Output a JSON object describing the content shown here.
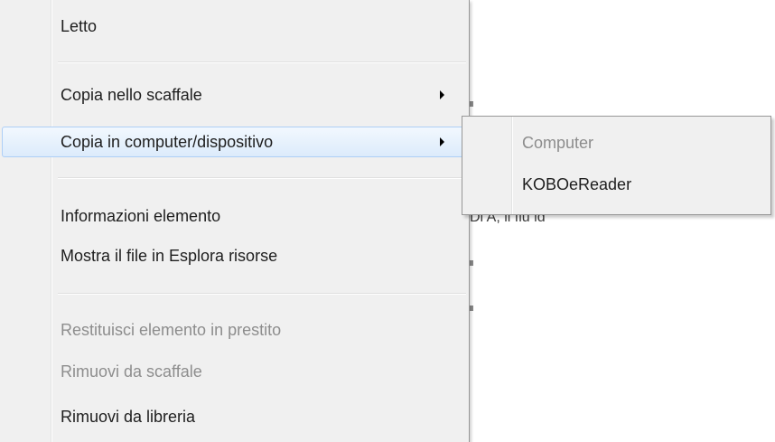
{
  "background": {
    "partial_text": "Di A, il fiu ld"
  },
  "context_menu": {
    "items": [
      {
        "label": "Letto",
        "disabled": false,
        "submenu": false
      },
      {
        "label": "Copia nello scaffale",
        "disabled": false,
        "submenu": true
      },
      {
        "label": "Copia in computer/dispositivo",
        "disabled": false,
        "submenu": true,
        "highlighted": true
      },
      {
        "label": "Informazioni elemento",
        "disabled": false,
        "submenu": false
      },
      {
        "label": "Mostra il file in Esplora risorse",
        "disabled": false,
        "submenu": false
      },
      {
        "label": "Restituisci elemento in prestito",
        "disabled": true,
        "submenu": false
      },
      {
        "label": "Rimuovi da scaffale",
        "disabled": true,
        "submenu": false
      },
      {
        "label": "Rimuovi da libreria",
        "disabled": false,
        "submenu": false
      }
    ]
  },
  "submenu": {
    "items": [
      {
        "label": "Computer",
        "disabled": true
      },
      {
        "label": "KOBOeReader",
        "disabled": false
      }
    ]
  },
  "colors": {
    "menu_bg": "#f0f0f0",
    "highlight_border": "#aecff6",
    "highlight_fill": "#dcebfb",
    "disabled_text": "#8d8d8d"
  }
}
